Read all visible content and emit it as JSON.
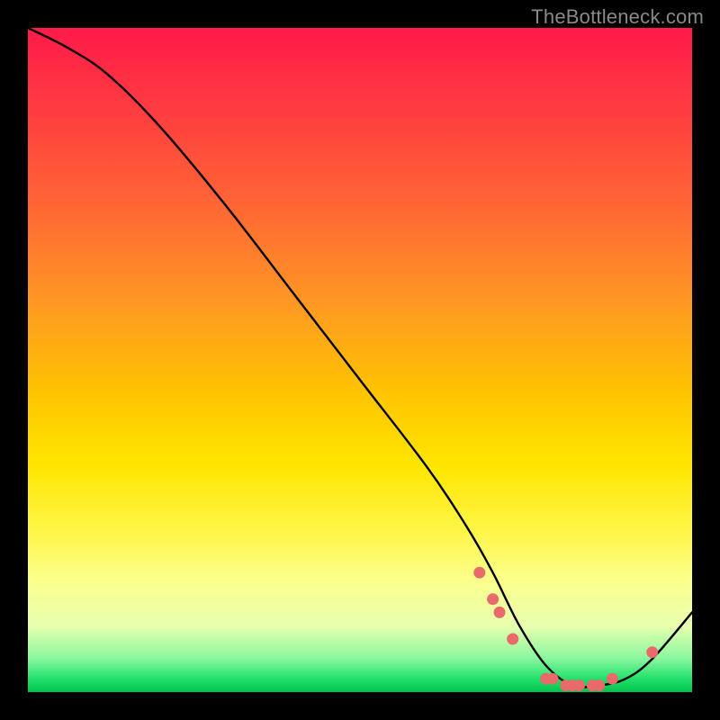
{
  "watermark": "TheBottleneck.com",
  "chart_data": {
    "type": "line",
    "title": "",
    "xlabel": "",
    "ylabel": "",
    "xlim": [
      0,
      100
    ],
    "ylim": [
      0,
      100
    ],
    "series": [
      {
        "name": "bottleneck-curve",
        "x": [
          0,
          6,
          12,
          20,
          30,
          40,
          50,
          60,
          66,
          70,
          74,
          78,
          82,
          86,
          90,
          94,
          100
        ],
        "y": [
          100,
          97,
          93,
          85,
          73,
          60,
          47,
          34,
          25,
          18,
          10,
          4,
          1,
          1,
          2,
          5,
          12
        ]
      }
    ],
    "markers": {
      "name": "highlighted-points",
      "color": "#e86a6a",
      "x": [
        68,
        70,
        71,
        73,
        78,
        79,
        81,
        82,
        83,
        85,
        86,
        88,
        94
      ],
      "y": [
        18,
        14,
        12,
        8,
        2,
        2,
        1,
        1,
        1,
        1,
        1,
        2,
        6
      ]
    }
  }
}
